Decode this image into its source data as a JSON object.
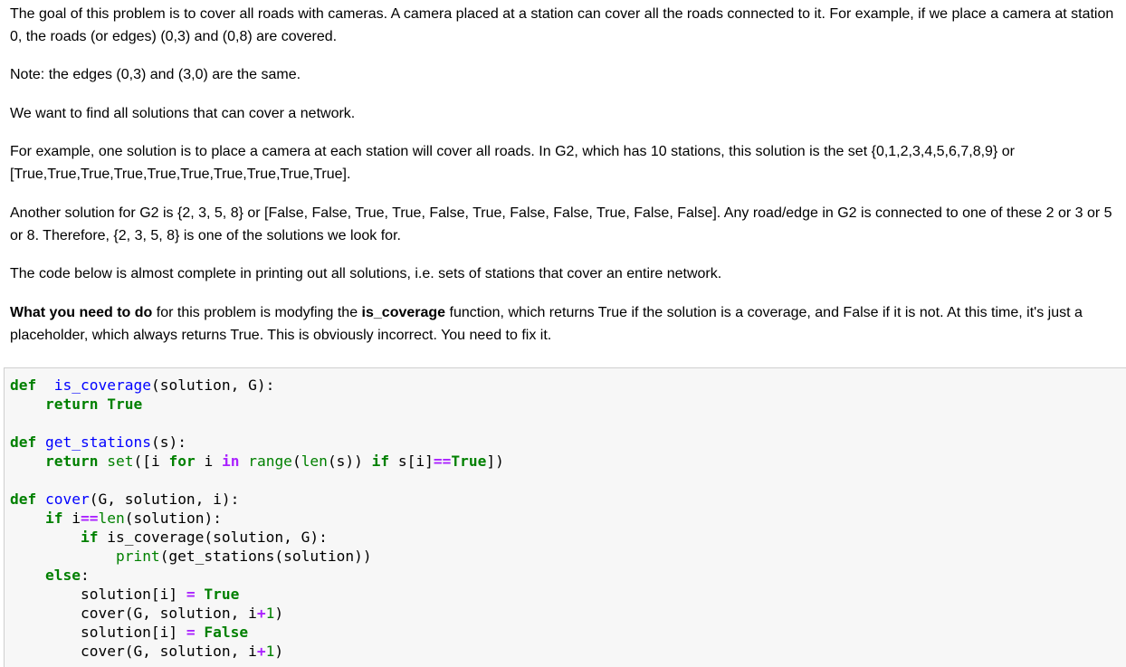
{
  "paragraphs": {
    "p1": "The goal of this problem is to cover all roads with cameras. A camera placed at a station can cover all the roads connected to it. For example, if we place a camera at station 0, the roads (or edges) (0,3) and (0,8) are covered.",
    "p2": "Note: the edges (0,3) and (3,0) are the same.",
    "p3": "We want to find all solutions that can cover a network.",
    "p4": "For example, one solution is to place a camera at each station will cover all roads. In G2, which has 10 stations, this solution is the set {0,1,2,3,4,5,6,7,8,9} or [True,True,True,True,True,True,True,True,True,True].",
    "p5": "Another solution for G2 is {2, 3, 5, 8} or [False, False, True, True, False, True, False, False, True, False, False]. Any road/edge in G2 is connected to one of these 2 or 3 or 5 or 8. Therefore, {2, 3, 5, 8} is one of the solutions we look for.",
    "p6": "The code below is almost complete in printing out all solutions, i.e. sets of stations that cover an entire network.",
    "p7_bold1": "What you need to do",
    "p7_text1": " for this problem is modyfing the ",
    "p7_bold2": "is_coverage",
    "p7_text2": " function, which returns True if the solution is a coverage, and False if it is not. At this time, it's just a placeholder, which always returns True. This is obviously incorrect. You need to fix it."
  },
  "code": {
    "l1": [
      [
        "kw",
        "def"
      ],
      [
        "",
        "  "
      ],
      [
        "fn",
        "is_coverage"
      ],
      [
        "",
        "(solution, G):"
      ]
    ],
    "l2": [
      [
        "",
        "    "
      ],
      [
        "kw",
        "return"
      ],
      [
        "",
        " "
      ],
      [
        "kw",
        "True"
      ]
    ],
    "l3": [],
    "l4": [
      [
        "kw",
        "def"
      ],
      [
        "",
        " "
      ],
      [
        "fn",
        "get_stations"
      ],
      [
        "",
        "(s):"
      ]
    ],
    "l5": [
      [
        "",
        "    "
      ],
      [
        "kw",
        "return"
      ],
      [
        "",
        " "
      ],
      [
        "bi",
        "set"
      ],
      [
        "",
        "([i "
      ],
      [
        "kw",
        "for"
      ],
      [
        "",
        " i "
      ],
      [
        "op",
        "in"
      ],
      [
        "",
        " "
      ],
      [
        "bi",
        "range"
      ],
      [
        "",
        "("
      ],
      [
        "bi",
        "len"
      ],
      [
        "",
        "(s)) "
      ],
      [
        "kw",
        "if"
      ],
      [
        "",
        " s[i]"
      ],
      [
        "op",
        "=="
      ],
      [
        "kw",
        "True"
      ],
      [
        "",
        "])"
      ]
    ],
    "l6": [],
    "l7": [
      [
        "kw",
        "def"
      ],
      [
        "",
        " "
      ],
      [
        "fn",
        "cover"
      ],
      [
        "",
        "(G, solution, i):"
      ]
    ],
    "l8": [
      [
        "",
        "    "
      ],
      [
        "kw",
        "if"
      ],
      [
        "",
        " i"
      ],
      [
        "op",
        "=="
      ],
      [
        "bi",
        "len"
      ],
      [
        "",
        "(solution):"
      ]
    ],
    "l9": [
      [
        "",
        "        "
      ],
      [
        "kw",
        "if"
      ],
      [
        "",
        " is_coverage(solution, G):"
      ]
    ],
    "l10": [
      [
        "",
        "            "
      ],
      [
        "bi",
        "print"
      ],
      [
        "",
        "(get_stations(solution))"
      ]
    ],
    "l11": [
      [
        "",
        "    "
      ],
      [
        "kw",
        "else"
      ],
      [
        "",
        ":"
      ]
    ],
    "l12": [
      [
        "",
        "        solution[i] "
      ],
      [
        "op",
        "="
      ],
      [
        "",
        " "
      ],
      [
        "kw",
        "True"
      ]
    ],
    "l13": [
      [
        "",
        "        cover(G, solution, i"
      ],
      [
        "op",
        "+"
      ],
      [
        "num",
        "1"
      ],
      [
        "",
        ")"
      ]
    ],
    "l14": [
      [
        "",
        "        solution[i] "
      ],
      [
        "op",
        "="
      ],
      [
        "",
        " "
      ],
      [
        "kw",
        "False"
      ]
    ],
    "l15": [
      [
        "",
        "        cover(G, solution, i"
      ],
      [
        "op",
        "+"
      ],
      [
        "num",
        "1"
      ],
      [
        "",
        ")"
      ]
    ]
  }
}
